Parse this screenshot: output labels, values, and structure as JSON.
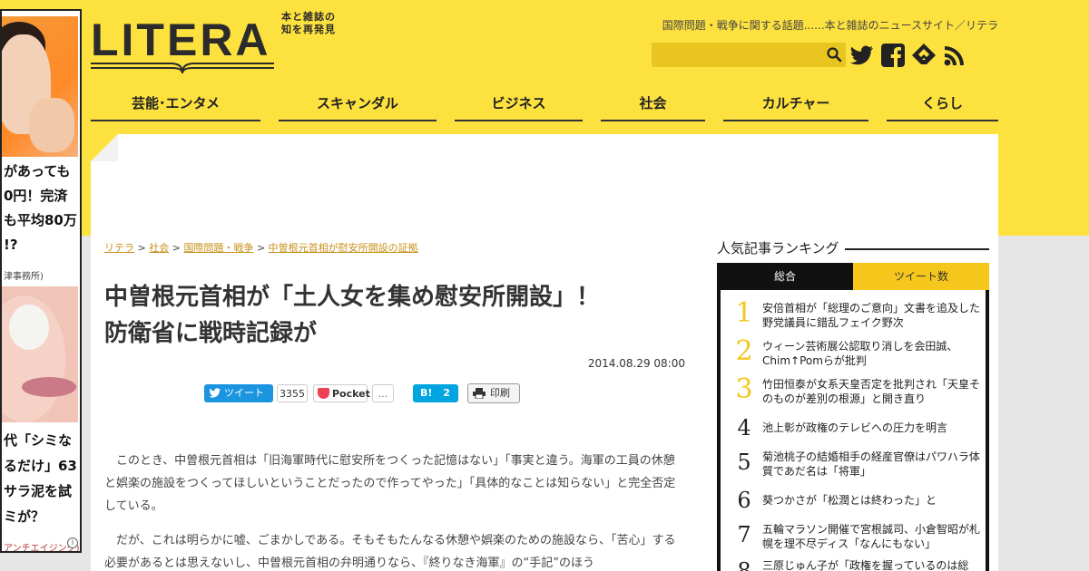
{
  "header": {
    "logo_text": "LITERA",
    "logo_tagline_1": "本と雑誌の",
    "logo_tagline_2": "知を再発見",
    "tagline": "国際問題・戦争に関する話題......本と雑誌のニュースサイト／リテラ",
    "search": {
      "placeholder": "",
      "icon": "search-icon"
    },
    "social_icons": [
      "twitter-icon",
      "facebook-icon",
      "feedly-icon",
      "rss-icon"
    ]
  },
  "nav": {
    "items": [
      {
        "label": "芸能･エンタメ"
      },
      {
        "label": "スキャンダル"
      },
      {
        "label": "ビジネス"
      },
      {
        "label": "社会"
      },
      {
        "label": "カルチャー"
      },
      {
        "label": "くらし"
      }
    ]
  },
  "left_ad": {
    "text1": [
      "があっても",
      "0円！完済",
      "も平均80万",
      "!?"
    ],
    "source1": "津事務所)",
    "text2": [
      "代「シミな",
      "るだけ」63",
      "サラ泥を試",
      "ミが？"
    ],
    "source2": "アンチエイジング)",
    "info_label": "i"
  },
  "breadcrumb": {
    "items": [
      "リテラ",
      "社会",
      "国際問題・戦争",
      "中曽根元首相が慰安所開設の証拠"
    ],
    "separator": ">"
  },
  "article": {
    "title_line1": "中曽根元首相が「土人女を集め慰安所開設」！",
    "title_line2": "防衛省に戦時記録が",
    "date": "2014.08.29 08:00",
    "paragraphs": [
      "このとき、中曽根元首相は「旧海軍時代に慰安所をつくった記憶はない」「事実と違う。海軍の工員の休憩と娯楽の施設をつくってほしいということだったので作ってやった」「具体的なことは知らない」と完全否定している。",
      "だが、これは明らかに嘘、ごまかしである。そもそもたんなる休憩や娯楽のための施設なら、「苦心」する必要があるとは思えないし、中曽根元首相の弁明通りなら、『終りなき海軍』の“手記”のほう"
    ]
  },
  "share": {
    "tweet_label": "ツイート",
    "tweet_count": "3355",
    "pocket_label": "Pocket",
    "pocket_count": "...",
    "hatena_label": "B!",
    "hatena_count": "2",
    "print_label": "印刷"
  },
  "ranking": {
    "title": "人気記事ランキング",
    "tabs": [
      "総合",
      "ツイート数"
    ],
    "items": [
      {
        "rank": "1",
        "text": "安倍首相が「総理のご意向」文書を追及した野党議員に錯乱フェイク野次"
      },
      {
        "rank": "2",
        "text": "ウィーン芸術展公認取り消しを会田誠、Chim↑Pomらが批判"
      },
      {
        "rank": "3",
        "text": "竹田恒泰が女系天皇否定を批判され「天皇そのものが差別の根源」と開き直り"
      },
      {
        "rank": "4",
        "text": "池上彰が政権のテレビへの圧力を明言"
      },
      {
        "rank": "5",
        "text": "菊池桃子の結婚相手の経産官僚はパワハラ体質であだ名は「将軍」"
      },
      {
        "rank": "6",
        "text": "葵つかさが「松潤とは終わった」と"
      },
      {
        "rank": "7",
        "text": "五輪マラソン開催で宮根誠司、小倉智昭が札幌を理不尽ディス「なんにもない」"
      },
      {
        "rank": "8",
        "text": "三原じゅん子が「政権を握っているのは総"
      }
    ]
  },
  "colors": {
    "brand_yellow": "#fde13f",
    "tab_gold": "#f5c71c",
    "link": "#c8911a",
    "twitter_blue": "#1b95e0",
    "hatena_blue": "#00a4de",
    "pocket_red": "#ef4056"
  }
}
